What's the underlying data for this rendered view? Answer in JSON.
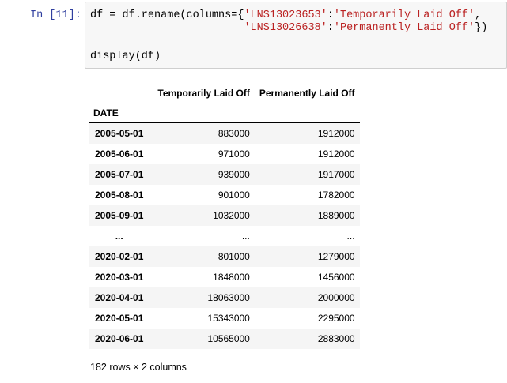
{
  "cell": {
    "prompt": "In [11]:",
    "code": {
      "line1_a": "df = df.rename(columns={",
      "line1_key": "'LNS13023653'",
      "line1_sep": ":",
      "line1_val": "'Temporarily Laid Off'",
      "line1_end": ",",
      "line2_indent": "                        ",
      "line2_key": "'LNS13026638'",
      "line2_sep": ":",
      "line2_val": "'Permanently Laid Off'",
      "line2_end": "})",
      "line4": "display(df)"
    }
  },
  "dataframe": {
    "columns": [
      "Temporarily Laid Off",
      "Permanently Laid Off"
    ],
    "index_name": "DATE",
    "rows": [
      {
        "date": "2005-05-01",
        "temp": "883000",
        "perm": "1912000"
      },
      {
        "date": "2005-06-01",
        "temp": "971000",
        "perm": "1912000"
      },
      {
        "date": "2005-07-01",
        "temp": "939000",
        "perm": "1917000"
      },
      {
        "date": "2005-08-01",
        "temp": "901000",
        "perm": "1782000"
      },
      {
        "date": "2005-09-01",
        "temp": "1032000",
        "perm": "1889000"
      },
      {
        "date": "...",
        "temp": "...",
        "perm": "..."
      },
      {
        "date": "2020-02-01",
        "temp": "801000",
        "perm": "1279000"
      },
      {
        "date": "2020-03-01",
        "temp": "1848000",
        "perm": "1456000"
      },
      {
        "date": "2020-04-01",
        "temp": "18063000",
        "perm": "2000000"
      },
      {
        "date": "2020-05-01",
        "temp": "15343000",
        "perm": "2295000"
      },
      {
        "date": "2020-06-01",
        "temp": "10565000",
        "perm": "2883000"
      }
    ],
    "shape_text": "182 rows × 2 columns"
  }
}
